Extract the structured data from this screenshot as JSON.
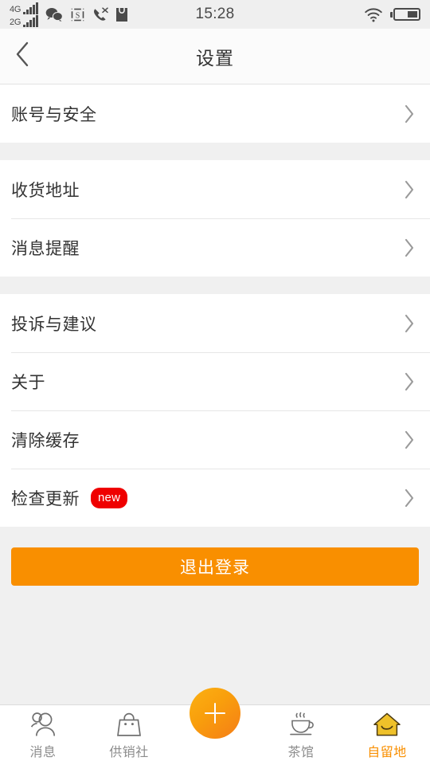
{
  "status_bar": {
    "network_4g_label": "4G",
    "network_2g_label": "2G",
    "time": "15:28",
    "icons": [
      "wechat-icon",
      "screenshot-s-icon",
      "missed-call-icon",
      "bag-icon",
      "wifi-icon",
      "battery-icon"
    ]
  },
  "header": {
    "title": "设置",
    "back_icon": "chevron-left-icon"
  },
  "groups": [
    {
      "items": [
        {
          "label": "账号与安全",
          "badge": null
        }
      ]
    },
    {
      "items": [
        {
          "label": "收货地址",
          "badge": null
        },
        {
          "label": "消息提醒",
          "badge": null
        }
      ]
    },
    {
      "items": [
        {
          "label": "投诉与建议",
          "badge": null
        },
        {
          "label": "关于",
          "badge": null
        },
        {
          "label": "清除缓存",
          "badge": null
        },
        {
          "label": "检查更新",
          "badge": "new"
        }
      ]
    }
  ],
  "logout": {
    "label": "退出登录",
    "color": "#f98f00"
  },
  "tabbar": {
    "items": [
      {
        "label": "消息",
        "icon": "people-icon",
        "active": false
      },
      {
        "label": "供销社",
        "icon": "shopping-bag-icon",
        "active": false
      },
      {
        "label": "茶馆",
        "icon": "teacup-icon",
        "active": false
      },
      {
        "label": "自留地",
        "icon": "house-icon",
        "active": true
      }
    ],
    "fab": {
      "icon": "plus-icon"
    },
    "active_color": "#f98f00",
    "inactive_color": "#8c8c8c"
  }
}
